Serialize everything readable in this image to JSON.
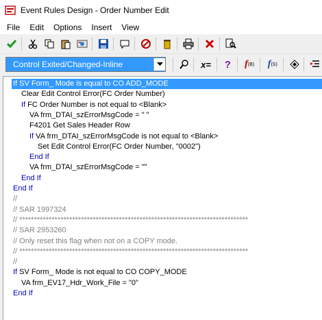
{
  "window": {
    "title": "Event Rules Design - Order Number Edit"
  },
  "menu": [
    "File",
    "Edit",
    "Options",
    "Insert",
    "View"
  ],
  "toolbar1_icons": [
    "ok-check-icon",
    "cut-icon",
    "copy-icon",
    "paste-icon",
    "map-icon",
    "save-icon",
    "comment-icon",
    "disable-icon",
    "delete-trash-icon",
    "print-icon",
    "cancel-x-icon",
    "find-icon"
  ],
  "event_select": {
    "value": "Control Exited/Changed-Inline"
  },
  "toolbar2_icons": {
    "assign_label": "x=",
    "help_label": "?",
    "f_label": "f",
    "f_sub1": "(B)",
    "f_sub2": "(S)"
  },
  "code": [
    {
      "indent": 0,
      "kw": "If",
      "text": " SV Form_ Mode is equal to CO ADD_MODE",
      "type": "code",
      "selected": true
    },
    {
      "indent": 1,
      "kw": "",
      "text": "Clear Edit Control Error(FC Order Number)",
      "type": "code"
    },
    {
      "indent": 1,
      "kw": "If",
      "text": " FC Order Number is not equal to <Blank>",
      "type": "code"
    },
    {
      "indent": 2,
      "kw": "",
      "text": "VA frm_DTAI_szErrorMsgCode = \" \"",
      "type": "code"
    },
    {
      "indent": 2,
      "kw": "",
      "text": "F4201 Get Sales Header Row",
      "type": "code"
    },
    {
      "indent": 2,
      "kw": "If",
      "text": " VA frm_DTAI_szErrorMsgCode is not equal to <Blank>",
      "type": "code"
    },
    {
      "indent": 3,
      "kw": "",
      "text": "Set Edit Control Error(FC Order Number, \"0002\")",
      "type": "code"
    },
    {
      "indent": 2,
      "kw": "End If",
      "text": "",
      "type": "code"
    },
    {
      "indent": 2,
      "kw": "",
      "text": "VA frm_DTAI_szErrorMsgCode = \"\"",
      "type": "code"
    },
    {
      "indent": 1,
      "kw": "End If",
      "text": "",
      "type": "code"
    },
    {
      "indent": 0,
      "kw": "End If",
      "text": "",
      "type": "code"
    },
    {
      "indent": 0,
      "kw": "",
      "text": "//",
      "type": "comment"
    },
    {
      "indent": 0,
      "kw": "",
      "text": "// SAR 1997324",
      "type": "comment"
    },
    {
      "indent": 0,
      "kw": "",
      "text": "// ******************************************************************************",
      "type": "comment"
    },
    {
      "indent": 0,
      "kw": "",
      "text": "// SAR 2953260",
      "type": "comment"
    },
    {
      "indent": 0,
      "kw": "",
      "text": "// Only reset this flag when not on a COPY mode.",
      "type": "comment"
    },
    {
      "indent": 0,
      "kw": "",
      "text": "// ******************************************************************************",
      "type": "comment"
    },
    {
      "indent": 0,
      "kw": "",
      "text": "//",
      "type": "comment"
    },
    {
      "indent": 0,
      "kw": "If",
      "text": " SV Form_ Mode is not equal to CO COPY_MODE",
      "type": "code"
    },
    {
      "indent": 1,
      "kw": "",
      "text": "VA frm_EV17_Hdr_Work_File = \"0\"",
      "type": "code"
    },
    {
      "indent": 0,
      "kw": "End If",
      "text": "",
      "type": "code"
    }
  ]
}
